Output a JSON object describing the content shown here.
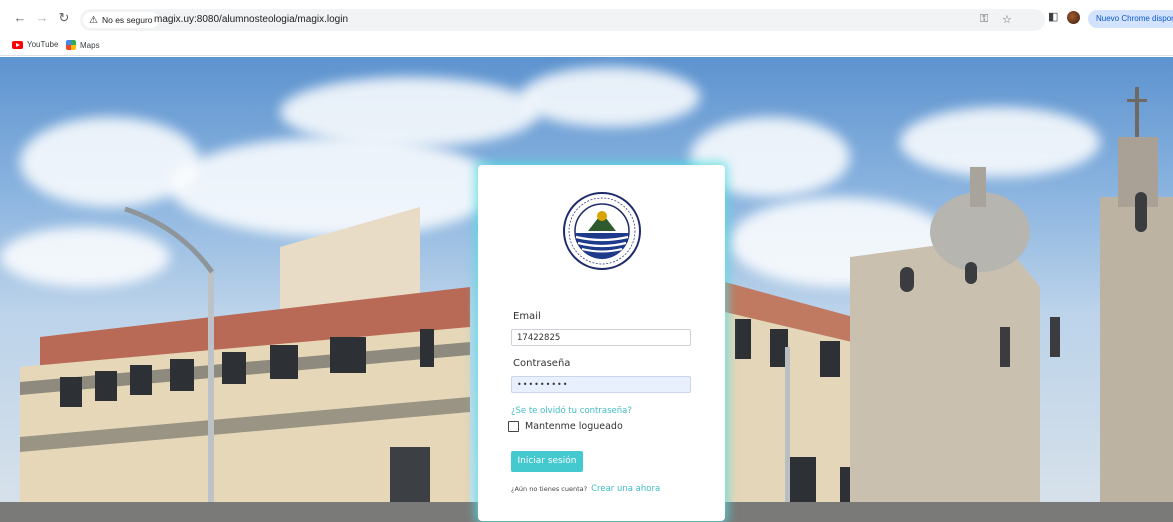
{
  "browser": {
    "security_label": "No es seguro",
    "url": "magix.uy:8080/alumnosteologia/magix.login",
    "profile_button": "Nuevo Chrome disponible",
    "bookmarks": [
      {
        "label": "YouTube",
        "icon": "youtube-icon"
      },
      {
        "label": "Maps",
        "icon": "maps-icon"
      }
    ]
  },
  "login": {
    "logo_text": "FACULTAD DE TEOLOGÍA DEL URUGUAY",
    "logo_subtext": "Mons. Mariano Soler",
    "email_label": "Email",
    "email_value": "17422825",
    "password_label": "Contraseña",
    "password_value": "•••••••••",
    "forgot_link": "¿Se te olvidó tu contraseña?",
    "remember_label": "Mantenme logueado",
    "remember_checked": false,
    "submit_label": "Iniciar sesión",
    "signup_question": "¿Aún no tienes cuenta?",
    "signup_link": "Crear una ahora"
  },
  "colors": {
    "accent": "#44c9cf",
    "link": "#3fbdc3",
    "card_glow": "#50dce1"
  }
}
